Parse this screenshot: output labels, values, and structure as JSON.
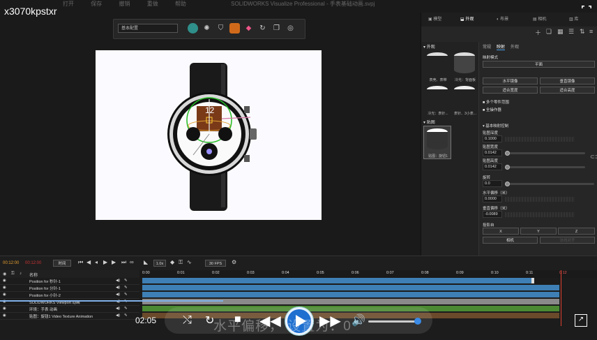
{
  "watermark": "x3070kpstxr",
  "menubar": [
    "打开",
    "保存",
    "撤销",
    "重做",
    "帮助"
  ],
  "app_title": "SOLIDWORKS Visualize Professional - 手表基础动画.svpj",
  "toolbar": {
    "preset": "基本配置"
  },
  "right_panel": {
    "tabs": [
      "模型",
      "外观",
      "布景",
      "相机",
      "库"
    ],
    "active_tab": "外观",
    "left_sections": [
      {
        "title": "外观",
        "materials": [
          {
            "label": "表壳、表带",
            "color": "#222"
          },
          {
            "label": "冷光：背面板",
            "color": "#555"
          },
          {
            "label": "冷光：表针...",
            "color": "#eee"
          },
          {
            "label": "表针、3小表...",
            "color": "#333"
          }
        ]
      },
      {
        "title": "贴图",
        "materials": [
          {
            "label": "贴图：旋钮1",
            "color": "#eee"
          }
        ]
      }
    ],
    "props_tabs": [
      "常规",
      "映射",
      "外观"
    ],
    "active_props_tab": "映射",
    "mapping_mode_label": "映射模式",
    "mapping_mode_value": "平面",
    "buttons_row1": [
      "水平镜像",
      "垂直镜像"
    ],
    "buttons_row2": [
      "适合宽度",
      "适合高度"
    ],
    "checkbox1": "多个零件范围",
    "checkbox2": "全操作器",
    "basic_mapping": "基本映射控制",
    "fields": [
      {
        "label": "贴图深度",
        "value": "0.1000"
      },
      {
        "label": "贴图宽度",
        "value": "0.0142"
      },
      {
        "label": "贴图高度",
        "value": "0.0142"
      },
      {
        "label": "旋转",
        "value": "0.0"
      },
      {
        "label": "水平偏移（米）",
        "value": "0.0000"
      },
      {
        "label": "垂直偏移（米）",
        "value": "-0.0089"
      }
    ],
    "align_label": "投影自",
    "align_buttons": [
      "X",
      "Y",
      "Z"
    ],
    "camera_buttons": [
      "相机",
      "法线对齐"
    ]
  },
  "timeline": {
    "current_time": "00:12:00",
    "end_time": "00:12:00",
    "mode": "时间",
    "speed": "1.0x",
    "fps": "30 FPS",
    "name_header": "名称",
    "tracks": [
      {
        "name": "Position for 秒针-1",
        "color": "#3e7fb5"
      },
      {
        "name": "Position for 分针-1",
        "color": "#3e7fb5"
      },
      {
        "name": "Position for 小针-2",
        "color": "#3e7fb5"
      },
      {
        "name": "SOLIDWORKS Viewport 动画",
        "color": "#7a7a7a"
      },
      {
        "name": "环境：手表 动画",
        "color": "#4b8a32"
      },
      {
        "name": "贴图：旋钮1 Video Texture Animation",
        "color": "#8a5a2a"
      }
    ],
    "ruler": [
      "0:00",
      "0:01",
      "0:02",
      "0:03",
      "0:04",
      "0:05",
      "0:06",
      "0:07",
      "0:08",
      "0:09",
      "0:10",
      "0:11",
      "0:12"
    ]
  },
  "video": {
    "time": "02:05",
    "subtitle": "水平偏移，  设置为：0"
  }
}
